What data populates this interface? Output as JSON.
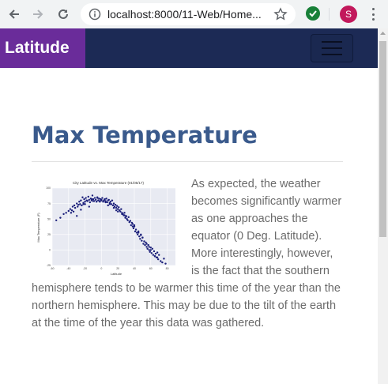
{
  "browser": {
    "url": "localhost:8000/11-Web/Home...",
    "profile_initial": "S"
  },
  "navbar": {
    "brand": "Latitude"
  },
  "main": {
    "title": "Max Temperature",
    "description": "As expected, the weather becomes significantly warmer as one approaches the equator (0 Deg. Latitude). More interestingly, however, is the fact that the southern hemisphere tends to be warmer this time of the year than the northern hemisphere. This may be due to the tilt of the earth at the time of the year this data was gathered."
  },
  "colors": {
    "brand_bg": "#6a2c9a",
    "navbar_bg": "#1c2a55",
    "title": "#3a5a8c",
    "point": "#1b1f7a"
  },
  "chart_data": {
    "type": "scatter",
    "title": "City Latitude vs. Max Temperature (01/05/17)",
    "xlabel": "Latitude",
    "ylabel": "Max Temperature (F)",
    "xlim": [
      -60,
      90
    ],
    "ylim": [
      -25,
      100
    ],
    "xticks": [
      -60,
      -40,
      -20,
      0,
      20,
      40,
      60,
      80
    ],
    "yticks": [
      -25,
      0,
      25,
      50,
      75,
      100
    ],
    "grid": true,
    "series": [
      {
        "x": [
          -55,
          -50,
          -46,
          -43,
          -40,
          -38,
          -36,
          -35,
          -34,
          -33,
          -32,
          -30,
          -29,
          -28,
          -27,
          -26,
          -25,
          -24,
          -23,
          -22,
          -21,
          -20,
          -19,
          -18,
          -17,
          -16,
          -15,
          -14,
          -13,
          -12,
          -11,
          -10,
          -9,
          -8,
          -7,
          -6,
          -5,
          -4,
          -3,
          -2,
          -1,
          0,
          1,
          2,
          3,
          4,
          5,
          6,
          7,
          8,
          9,
          10,
          11,
          12,
          13,
          14,
          15,
          16,
          17,
          18,
          19,
          20,
          21,
          22,
          23,
          24,
          25,
          26,
          27,
          28,
          29,
          30,
          31,
          32,
          33,
          34,
          35,
          36,
          37,
          38,
          39,
          40,
          41,
          42,
          43,
          44,
          45,
          46,
          47,
          48,
          49,
          50,
          51,
          52,
          53,
          54,
          55,
          56,
          57,
          58,
          59,
          60,
          61,
          62,
          63,
          64,
          65,
          66,
          67,
          68,
          69,
          70,
          72,
          74,
          76,
          78,
          -30,
          -25,
          -20,
          -15,
          -10,
          -5,
          0,
          5,
          10,
          15,
          20,
          25,
          30,
          35,
          40,
          45,
          50,
          55,
          60,
          65,
          -37,
          -22,
          -12,
          -2,
          8,
          18,
          28,
          38,
          48,
          58,
          68
        ],
        "y": [
          48,
          52,
          58,
          60,
          63,
          66,
          64,
          70,
          62,
          72,
          68,
          75,
          70,
          73,
          78,
          74,
          80,
          72,
          85,
          76,
          82,
          78,
          84,
          80,
          79,
          86,
          81,
          77,
          83,
          80,
          88,
          82,
          79,
          84,
          81,
          78,
          85,
          80,
          83,
          79,
          82,
          81,
          84,
          78,
          80,
          82,
          79,
          83,
          77,
          80,
          81,
          76,
          78,
          74,
          80,
          72,
          75,
          70,
          73,
          68,
          71,
          66,
          69,
          64,
          62,
          66,
          60,
          58,
          56,
          60,
          52,
          55,
          50,
          48,
          53,
          45,
          47,
          40,
          44,
          38,
          35,
          40,
          30,
          33,
          28,
          25,
          30,
          22,
          18,
          24,
          15,
          20,
          10,
          14,
          8,
          12,
          5,
          2,
          8,
          0,
          -3,
          4,
          -5,
          2,
          -8,
          -2,
          -10,
          -6,
          -12,
          -4,
          -15,
          -8,
          -18,
          -20,
          -14,
          -22,
          55,
          65,
          74,
          70,
          79,
          84,
          80,
          77,
          74,
          68,
          62,
          58,
          54,
          47,
          38,
          28,
          20,
          10,
          0,
          -10,
          60,
          74,
          82,
          78,
          72,
          64,
          56,
          42,
          25,
          5,
          -12
        ]
      }
    ]
  }
}
